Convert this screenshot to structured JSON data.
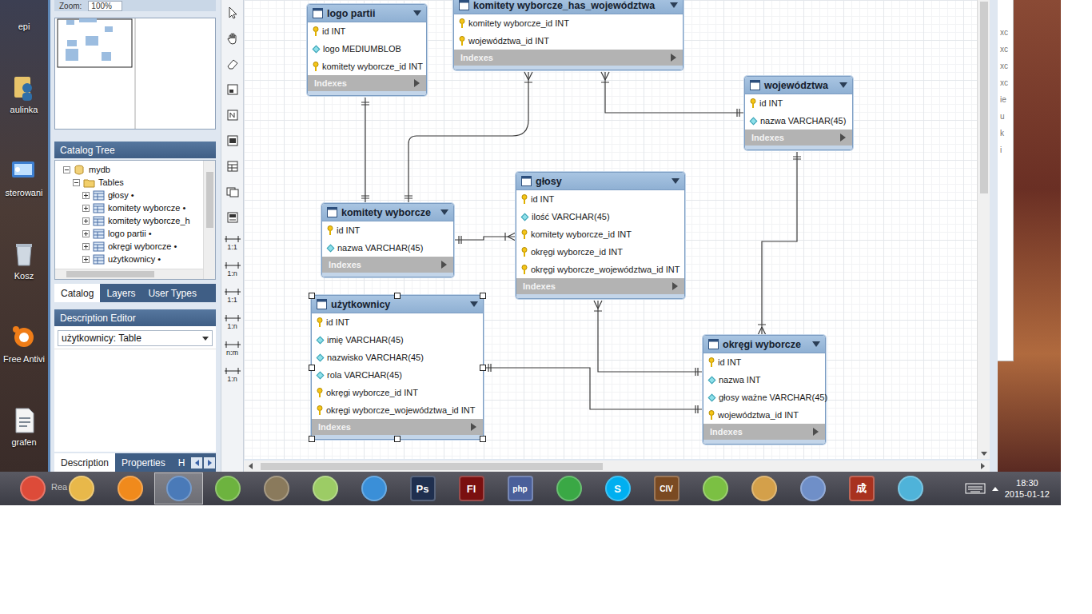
{
  "desktop": {
    "icons": [
      {
        "label": "epi"
      },
      {
        "label": "aulinka"
      },
      {
        "label": "sterowani"
      },
      {
        "label": "Kosz"
      },
      {
        "label": "Free Antivi"
      },
      {
        "label": "grafen"
      }
    ]
  },
  "workbench": {
    "zoom": {
      "label": "Zoom:",
      "value": "100%"
    },
    "catalog_tree": {
      "title": "Catalog Tree",
      "nodes": [
        {
          "label": "mydb",
          "expanded": true,
          "children": [
            {
              "label": "Tables",
              "expanded": true,
              "children": [
                {
                  "label": "głosy •",
                  "expanded": false
                },
                {
                  "label": "komitety wyborcze •",
                  "expanded": false
                },
                {
                  "label": "komitety wyborcze_h",
                  "expanded": false
                },
                {
                  "label": "logo partii •",
                  "expanded": false
                },
                {
                  "label": "okręgi wyborcze •",
                  "expanded": false
                },
                {
                  "label": "użytkownicy •",
                  "expanded": false
                }
              ]
            }
          ]
        }
      ]
    },
    "tabs": [
      {
        "label": "Catalog",
        "selected": true
      },
      {
        "label": "Layers",
        "selected": false
      },
      {
        "label": "User Types",
        "selected": false
      }
    ],
    "description_editor": {
      "title": "Description Editor",
      "select": "użytkownicy: Table"
    },
    "bottom_tabs": [
      {
        "label": "Description",
        "selected": true
      },
      {
        "label": "Properties",
        "selected": false
      },
      {
        "label": "H",
        "selected": false
      }
    ],
    "toolbar": {
      "relations": [
        "1:1",
        "1:n",
        "1:1",
        "1:n",
        "n:m",
        "1:n"
      ]
    }
  },
  "diagram": {
    "tables": [
      {
        "name": "logo partii",
        "selected": false,
        "footer": "Indexes",
        "columns": [
          {
            "text": "id INT",
            "kind": "key"
          },
          {
            "text": "logo MEDIUMBLOB",
            "kind": "column"
          },
          {
            "text": "komitety wyborcze_id INT",
            "kind": "key"
          }
        ]
      },
      {
        "name": "komitety wyborcze_has_województwa",
        "selected": false,
        "footer": "Indexes",
        "columns": [
          {
            "text": "komitety wyborcze_id INT",
            "kind": "key"
          },
          {
            "text": "województwa_id INT",
            "kind": "key"
          }
        ]
      },
      {
        "name": "województwa",
        "selected": false,
        "footer": "Indexes",
        "columns": [
          {
            "text": "id INT",
            "kind": "key"
          },
          {
            "text": "nazwa VARCHAR(45)",
            "kind": "column"
          }
        ]
      },
      {
        "name": "głosy",
        "selected": false,
        "footer": "Indexes",
        "columns": [
          {
            "text": "id INT",
            "kind": "key"
          },
          {
            "text": "ilość VARCHAR(45)",
            "kind": "column"
          },
          {
            "text": "komitety wyborcze_id INT",
            "kind": "key"
          },
          {
            "text": "okręgi wyborcze_id INT",
            "kind": "key"
          },
          {
            "text": "okręgi wyborcze_województwa_id INT",
            "kind": "key"
          }
        ]
      },
      {
        "name": "komitety wyborcze",
        "selected": false,
        "footer": "Indexes",
        "columns": [
          {
            "text": "id INT",
            "kind": "key"
          },
          {
            "text": "nazwa VARCHAR(45)",
            "kind": "column"
          }
        ]
      },
      {
        "name": "użytkownicy",
        "selected": true,
        "footer": "Indexes",
        "columns": [
          {
            "text": "id INT",
            "kind": "key"
          },
          {
            "text": "imię VARCHAR(45)",
            "kind": "column"
          },
          {
            "text": "nazwisko VARCHAR(45)",
            "kind": "column"
          },
          {
            "text": "rola VARCHAR(45)",
            "kind": "column"
          },
          {
            "text": "okręgi wyborcze_id INT",
            "kind": "key"
          },
          {
            "text": "okręgi wyborcze_województwa_id INT",
            "kind": "key"
          }
        ]
      },
      {
        "name": "okręgi wyborcze",
        "selected": false,
        "footer": "Indexes",
        "columns": [
          {
            "text": "id INT",
            "kind": "key"
          },
          {
            "text": "nazwa INT",
            "kind": "column"
          },
          {
            "text": "głosy ważne VARCHAR(45)",
            "kind": "column"
          },
          {
            "text": "województwa_id INT",
            "kind": "key"
          }
        ]
      }
    ]
  },
  "side_window": {
    "letters": [
      "xc",
      "xc",
      "xc",
      "xc",
      "ie",
      "u",
      "k",
      "i"
    ]
  },
  "taskbar": {
    "task_label": "Rea",
    "apps": [
      {
        "label": "",
        "color": "#dd4b39",
        "selected": false
      },
      {
        "label": "",
        "color": "#e8b84a",
        "selected": false
      },
      {
        "label": "",
        "color": "#f08a1c",
        "selected": false
      },
      {
        "label": "",
        "color": "#4a7ab8",
        "selected": true
      },
      {
        "label": "",
        "color": "#6db33f",
        "selected": false
      },
      {
        "label": "",
        "color": "#8a7a5c",
        "selected": false
      },
      {
        "label": "",
        "color": "#9ccc65",
        "selected": false
      },
      {
        "label": "",
        "color": "#3a8fd8",
        "selected": false
      },
      {
        "label": "Ps",
        "color": "#1f2f4f",
        "selected": false
      },
      {
        "label": "Fl",
        "color": "#7a1010",
        "selected": false
      },
      {
        "label": "php",
        "color": "#4a5f9a",
        "selected": false
      },
      {
        "label": "",
        "color": "#3aa845",
        "selected": false
      },
      {
        "label": "S",
        "color": "#00aff0",
        "selected": false
      },
      {
        "label": "CIV",
        "color": "#7a4a22",
        "selected": false
      },
      {
        "label": "",
        "color": "#7bc043",
        "selected": false
      },
      {
        "label": "",
        "color": "#d4a04a",
        "selected": false
      },
      {
        "label": "",
        "color": "#6f8fc8",
        "selected": false
      },
      {
        "label": "成",
        "color": "#a8321f",
        "selected": false
      },
      {
        "label": "",
        "color": "#4fb3d9",
        "selected": false
      }
    ],
    "clock": {
      "time": "18:30",
      "date": "2015-01-12"
    }
  }
}
